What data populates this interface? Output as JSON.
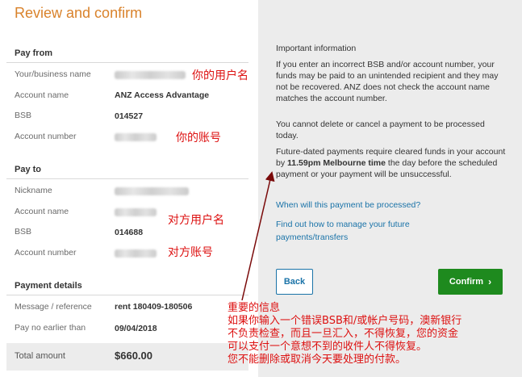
{
  "page": {
    "title": "Review and confirm"
  },
  "pay_from": {
    "heading": "Pay from",
    "rows": [
      {
        "label": "Your/business name",
        "value": ""
      },
      {
        "label": "Account name",
        "value": "ANZ Access Advantage"
      },
      {
        "label": "BSB",
        "value": "014527"
      },
      {
        "label": "Account number",
        "value": ""
      }
    ]
  },
  "pay_to": {
    "heading": "Pay to",
    "rows": [
      {
        "label": "Nickname",
        "value": ""
      },
      {
        "label": "Account name",
        "value": ""
      },
      {
        "label": "BSB",
        "value": "014688"
      },
      {
        "label": "Account number",
        "value": ""
      }
    ]
  },
  "payment_details": {
    "heading": "Payment details",
    "rows": [
      {
        "label": "Message / reference",
        "value": "rent 180409-180506"
      },
      {
        "label": "Pay no earlier than",
        "value": "09/04/2018"
      }
    ]
  },
  "total": {
    "label": "Total amount",
    "value": "$660.00"
  },
  "info": {
    "heading": "Important information",
    "para1": "If you enter an incorrect BSB and/or account number, your funds may be paid to an unintended recipient and they may not be recovered. ANZ does not check the account name matches the account number.",
    "para2": "You cannot delete or cancel a payment to be processed today.",
    "para3_a": "Future-dated payments require cleared funds in your account by ",
    "para3_b": "11.59pm Melbourne time",
    "para3_c": " the day before the scheduled payment or your payment will be unsuccessful.",
    "link1": "When will this payment be processed?",
    "link2": "Find out how to manage your future payments/transfers"
  },
  "buttons": {
    "back": "Back",
    "confirm": "Confirm"
  },
  "annotations": {
    "username": "你的用户名",
    "account_number": "你的账号",
    "payee_name": "对方用户名",
    "payee_account": "对方账号",
    "note_lines": [
      "重要的信息",
      "如果你输入一个错误BSB和/或帐户号码，澳新银行",
      "不负责检查，而且一旦汇入，不得恢复，您的资金",
      "可以支付一个意想不到的收件人不得恢复。",
      "您不能删除或取消今天要处理的付款。"
    ]
  },
  "colors": {
    "title": "#d9822b",
    "link": "#1a73a8",
    "confirm": "#1e8a1e",
    "annotation": "#dd1111"
  }
}
